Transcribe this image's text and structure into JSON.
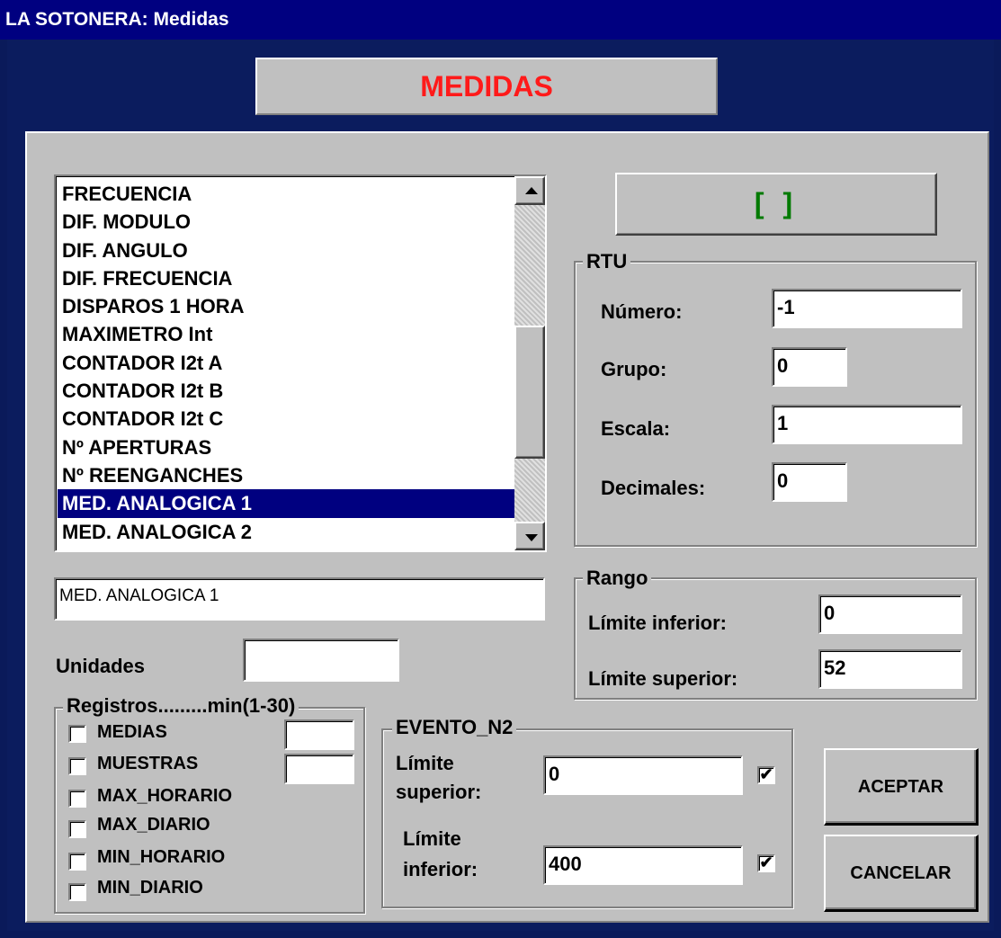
{
  "window": {
    "title": "LA SOTONERA: Medidas"
  },
  "header": {
    "title": "MEDIDAS"
  },
  "list": {
    "items": [
      "FRECUENCIA",
      "DIF. MODULO",
      "DIF. ANGULO",
      "DIF. FRECUENCIA",
      "DISPAROS 1 HORA",
      "MAXIMETRO Int",
      "CONTADOR I2t A",
      "CONTADOR I2t B",
      "CONTADOR I2t C",
      "Nº APERTURAS",
      "Nº REENGANCHES",
      "MED. ANALOGICA 1",
      "MED. ANALOGICA 2"
    ],
    "selected_index": 11
  },
  "name_field": {
    "value": "MED. ANALOGICA 1"
  },
  "status_display": {
    "text": "[ ]",
    "color": "#007a00"
  },
  "rtu": {
    "legend": "RTU",
    "numero_label": "Número:",
    "numero_value": "-1",
    "grupo_label": "Grupo:",
    "grupo_value": "0",
    "escala_label": "Escala:",
    "escala_value": "1",
    "decimales_label": "Decimales:",
    "decimales_value": "0"
  },
  "rango": {
    "legend": "Rango",
    "inferior_label": "Límite inferior:",
    "inferior_value": "0",
    "superior_label": "Límite superior:",
    "superior_value": "52"
  },
  "unidades": {
    "label": "Unidades",
    "value": ""
  },
  "registros": {
    "legend": "Registros.........min(1-30)",
    "medias": {
      "label": "MEDIAS",
      "checked": false,
      "value": ""
    },
    "muestras": {
      "label": "MUESTRAS",
      "checked": false,
      "value": ""
    },
    "max_horario": {
      "label": "MAX_HORARIO",
      "checked": false
    },
    "max_diario": {
      "label": "MAX_DIARIO",
      "checked": false
    },
    "min_horario": {
      "label": "MIN_HORARIO",
      "checked": false
    },
    "min_diario": {
      "label": "MIN_DIARIO",
      "checked": false
    }
  },
  "evento": {
    "legend": "EVENTO_N2",
    "superior_label_1": "Límite",
    "superior_label_2": "superior:",
    "superior_value": "0",
    "superior_checked": true,
    "inferior_label_1": "Límite",
    "inferior_label_2": "inferior:",
    "inferior_value": "400",
    "inferior_checked": true,
    "check_glyph": "✔"
  },
  "buttons": {
    "aceptar": "ACEPTAR",
    "cancelar": "CANCELAR"
  },
  "colors": {
    "titlebar": "#000080",
    "face": "#c0c0c0",
    "header_text": "#ff1a1a",
    "selection": "#000080"
  }
}
